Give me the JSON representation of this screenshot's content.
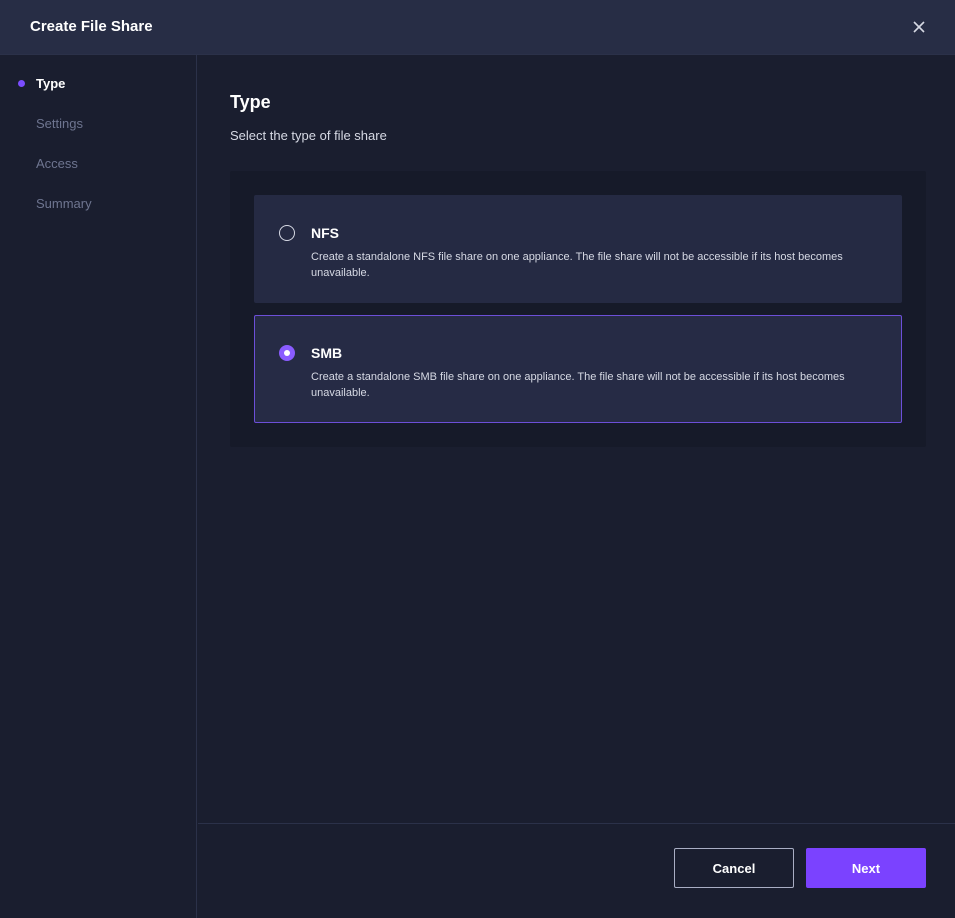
{
  "dialog": {
    "title": "Create File Share",
    "close_icon": "close-icon"
  },
  "steps": [
    {
      "label": "Type",
      "active": true
    },
    {
      "label": "Settings",
      "active": false
    },
    {
      "label": "Access",
      "active": false
    },
    {
      "label": "Summary",
      "active": false
    }
  ],
  "main": {
    "title": "Type",
    "subtitle": "Select the type of file share",
    "options": [
      {
        "title": "NFS",
        "description": "Create a standalone NFS file share on one appliance. The file share will not be accessible if its host becomes unavailable.",
        "selected": false
      },
      {
        "title": "SMB",
        "description": "Create a standalone SMB file share on one appliance. The file share will not be accessible if its host becomes unavailable.",
        "selected": true
      }
    ]
  },
  "footer": {
    "cancel_label": "Cancel",
    "next_label": "Next"
  },
  "colors": {
    "accent": "#7b42ff",
    "background": "#1a1e2f",
    "header": "#272d45",
    "card": "#252a43"
  }
}
